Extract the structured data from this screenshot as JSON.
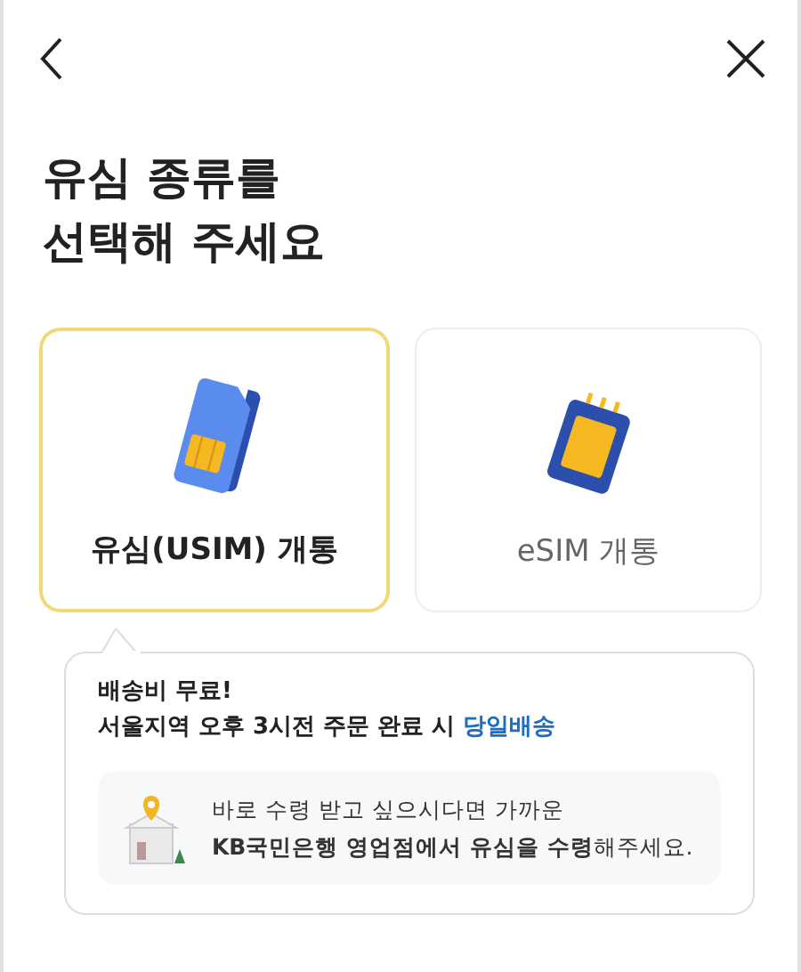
{
  "title_lines": [
    "유심 종류를",
    "선택해 주세요"
  ],
  "options": [
    {
      "label": "유심(USIM) 개통",
      "kind": "usim",
      "selected": true
    },
    {
      "label": "eSIM 개통",
      "kind": "esim",
      "selected": false
    }
  ],
  "info": {
    "headline": "배송비 무료!",
    "subline": "서울지역 오후 3시전 주문 완료 시",
    "highlight": "당일배송",
    "notice_lines": [
      "바로 수령 받고 싶으시다면 가까운",
      "**KB국민은행 영업점에서 유심을 수령**해주세요."
    ]
  }
}
